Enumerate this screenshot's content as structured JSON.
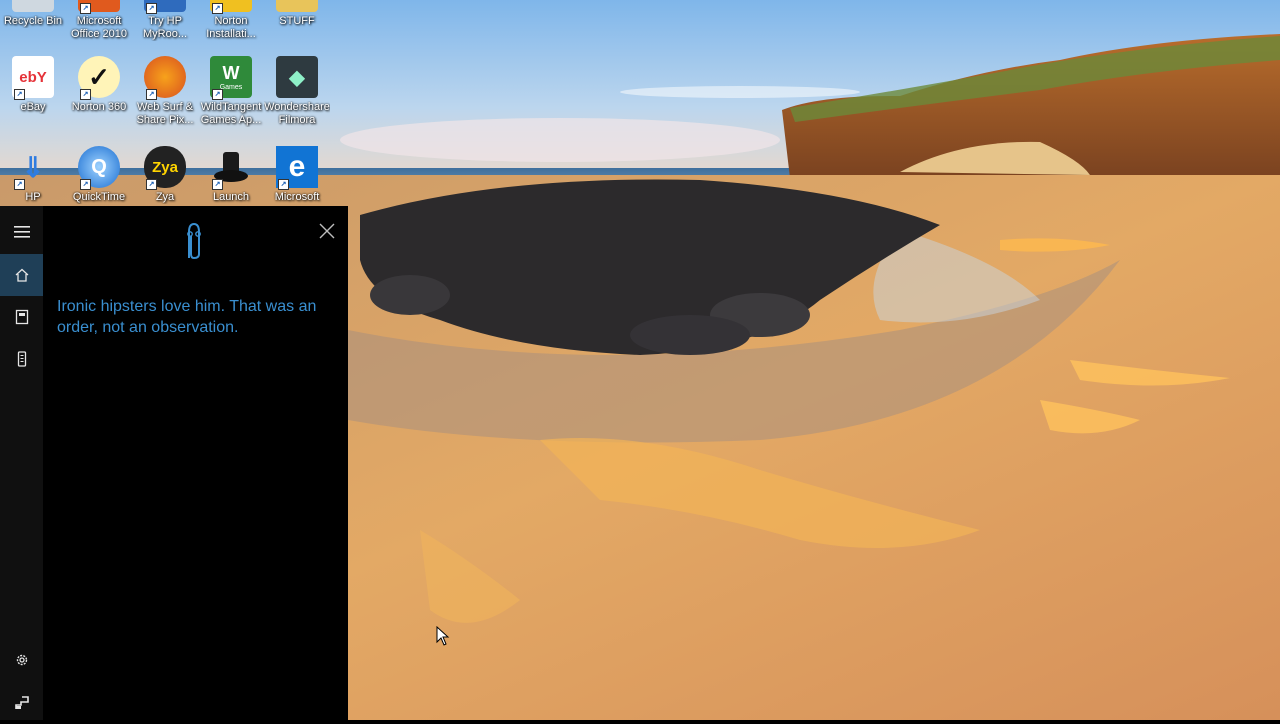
{
  "desktop": {
    "icons": [
      {
        "label": "Recycle Bin",
        "icon": "recycle-bin-icon"
      },
      {
        "label": "Microsoft Office 2010",
        "icon": "office-icon"
      },
      {
        "label": "Try HP MyRoo...",
        "icon": "hp-myroom-icon"
      },
      {
        "label": "Norton Installati...",
        "icon": "norton-installation-icon"
      },
      {
        "label": "STUFF",
        "icon": "folder-icon"
      },
      {
        "label": "eBay",
        "icon": "ebay-icon"
      },
      {
        "label": "Norton 360",
        "icon": "norton-360-icon"
      },
      {
        "label": "Web Surf & Share Pix...",
        "icon": "firefox-icon"
      },
      {
        "label": "WildTangent Games Ap...",
        "icon": "wildtangent-icon"
      },
      {
        "label": "Wondershare Filmora",
        "icon": "filmora-icon"
      },
      {
        "label": "HP",
        "icon": "hp-download-icon"
      },
      {
        "label": "QuickTime",
        "icon": "quicktime-icon"
      },
      {
        "label": "Zya",
        "icon": "zya-icon"
      },
      {
        "label": "Launch",
        "icon": "launch-hat-icon"
      },
      {
        "label": "Microsoft",
        "icon": "edge-icon"
      }
    ],
    "ebay_text": "ebY",
    "zya_text": "Zya",
    "games_text": "Games"
  },
  "cortana": {
    "message": "Ironic hipsters love him. That was an order, not an observation.",
    "rail_icons": [
      "hamburger-menu-icon",
      "home-icon",
      "notebook-icon",
      "devices-icon",
      "settings-icon",
      "feedback-icon"
    ],
    "accent": "#3a8fd0",
    "active_bg": "#1f3f57"
  }
}
